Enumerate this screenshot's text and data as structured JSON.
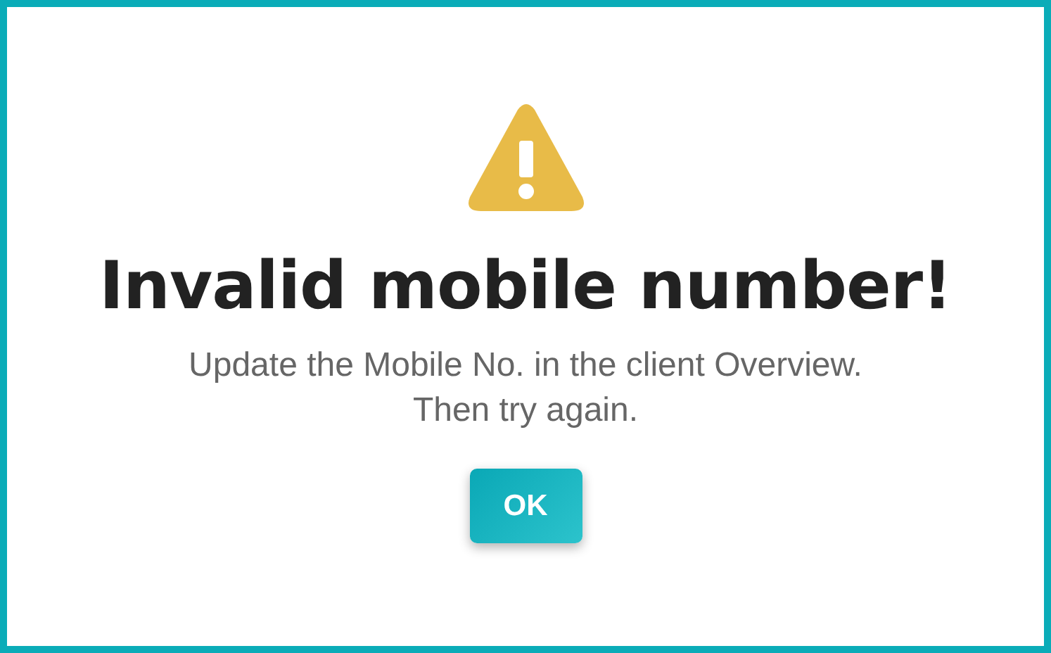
{
  "dialog": {
    "title": "Invalid mobile number!",
    "message_lines": [
      "Update the Mobile No. in the client Overview.",
      "Then try again."
    ],
    "buttons": [
      "OK"
    ]
  }
}
